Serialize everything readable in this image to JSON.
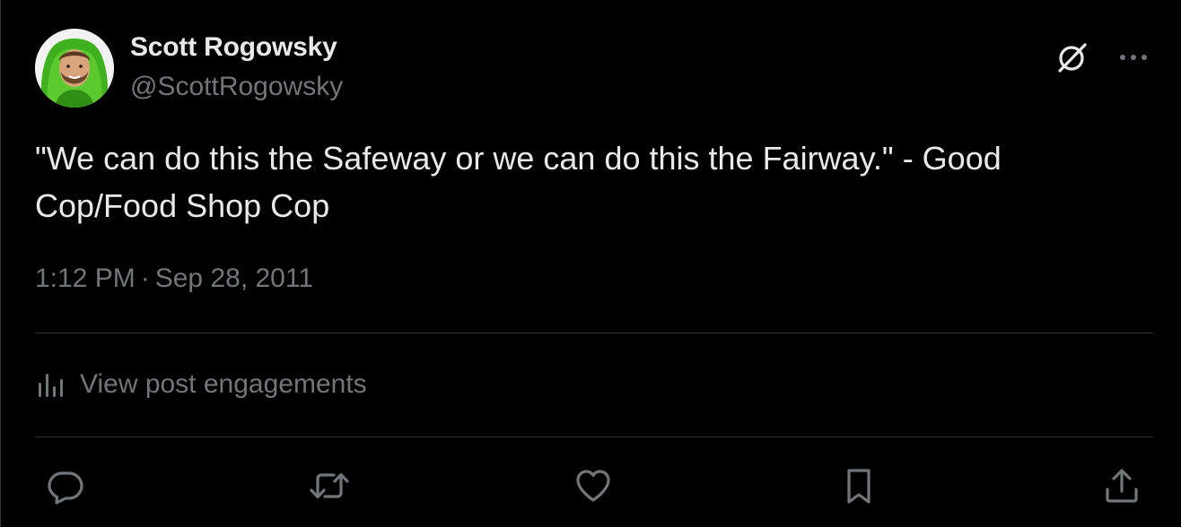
{
  "author": {
    "display_name": "Scott Rogowsky",
    "handle": "@ScottRogowsky"
  },
  "tweet": {
    "text": "\"We can do this the Safeway or we can do this the Fairway.\" - Good Cop/Food Shop Cop",
    "time": "1:12 PM",
    "separator": "·",
    "date": "Sep 28, 2011"
  },
  "engagements": {
    "label": "View post engagements"
  },
  "icons": {
    "grok": "grok-icon",
    "more": "more-icon",
    "analytics": "analytics-icon",
    "reply": "reply-icon",
    "repost": "repost-icon",
    "like": "heart-icon",
    "bookmark": "bookmark-icon",
    "share": "share-icon"
  },
  "colors": {
    "background": "#000000",
    "text_primary": "#e7e9ea",
    "text_secondary": "#71767b",
    "divider": "#2f3336"
  }
}
